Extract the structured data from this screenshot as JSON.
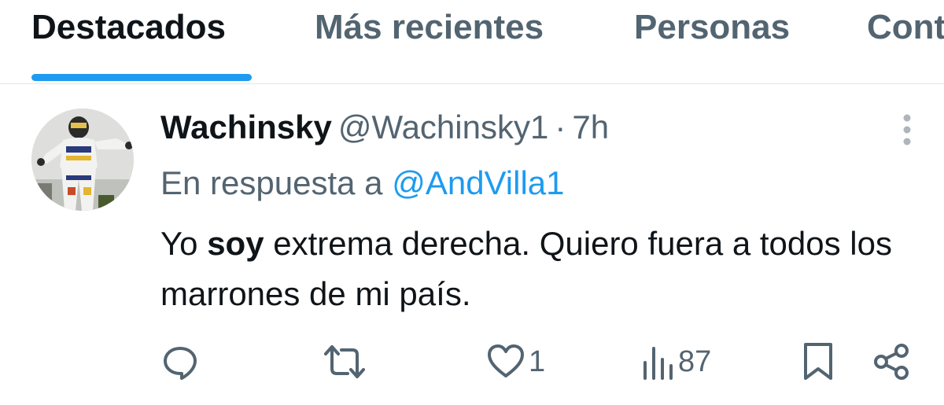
{
  "tabs": [
    {
      "label": "Destacados",
      "active": true
    },
    {
      "label": "Más recientes",
      "active": false
    },
    {
      "label": "Personas",
      "active": false
    },
    {
      "label": "Contenido multimedia",
      "active": false
    }
  ],
  "tweet": {
    "display_name": "Wachinsky",
    "handle": "@Wachinsky1",
    "separator": "·",
    "time": "7h",
    "reply_prefix": "En respuesta a",
    "reply_to": "@AndVilla1",
    "text_part1": "Yo ",
    "text_bold": "soy",
    "text_part2": " extrema derecha. Quiero fuera a todos los marrones de mi país.",
    "actions": {
      "reply_count": "",
      "retweet_count": "",
      "like_count": "1",
      "views_count": "87"
    }
  },
  "icons": {
    "more": "more-vertical-icon",
    "reply": "reply-icon",
    "retweet": "retweet-icon",
    "like": "heart-icon",
    "views": "views-icon",
    "bookmark": "bookmark-icon",
    "share": "share-icon"
  },
  "colors": {
    "accent": "#1d9bf0",
    "secondary_text": "#536471",
    "primary_text": "#0f1419"
  }
}
